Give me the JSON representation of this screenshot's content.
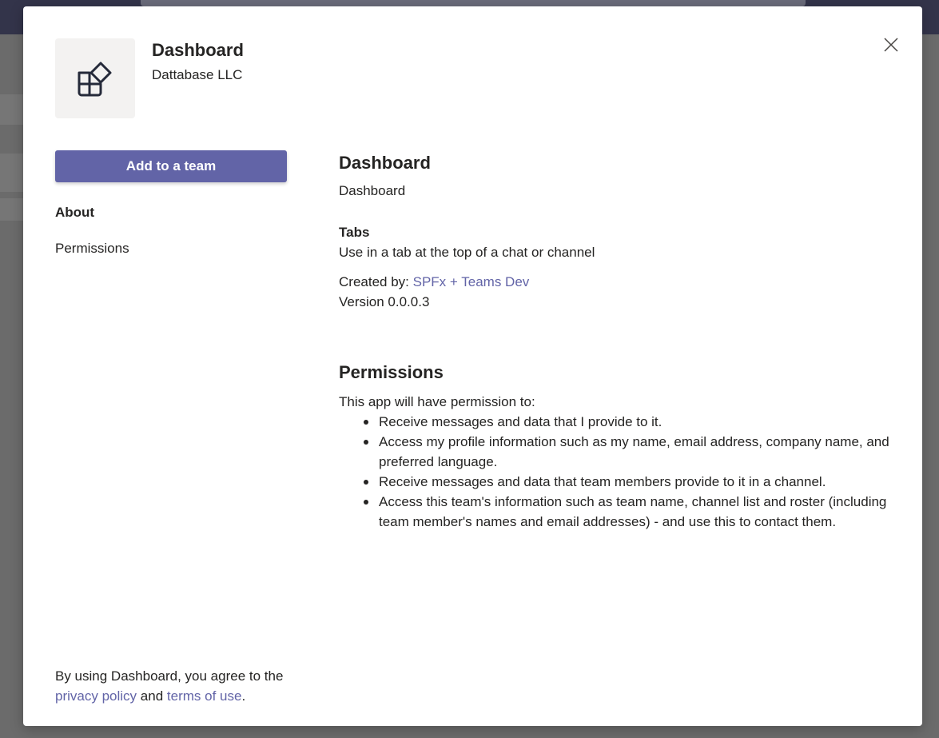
{
  "dialog": {
    "app": {
      "name": "Dashboard",
      "publisher": "Dattabase LLC",
      "icon": "app-icon"
    },
    "actions": {
      "add_label": "Add to a team",
      "close_icon": "close-icon"
    },
    "nav": {
      "about_label": "About",
      "permissions_label": "Permissions"
    },
    "about": {
      "title": "Dashboard",
      "description": "Dashboard",
      "tabs_title": "Tabs",
      "tabs_description": "Use in a tab at the top of a chat or channel",
      "created_by_label": "Created by:",
      "created_by_value": "SPFx + Teams Dev",
      "version": "Version 0.0.0.3"
    },
    "permissions": {
      "title": "Permissions",
      "intro": "This app will have permission to:",
      "items": [
        "Receive messages and data that I provide to it.",
        "Access my profile information such as my name, email address, company name, and preferred language.",
        "Receive messages and data that team members provide to it in a channel.",
        "Access this team's information such as team name, channel list and roster (including team member's names and email addresses) - and use this to contact them."
      ]
    },
    "footer": {
      "prefix": "By using Dashboard, you agree to the",
      "privacy_link": "privacy policy",
      "and": "and",
      "terms_link": "terms of use",
      "suffix": "."
    }
  },
  "colors": {
    "accent": "#6264a7",
    "text": "#252423",
    "overlay": "#6f6f6f",
    "icon_bg": "#f3f2f1"
  }
}
